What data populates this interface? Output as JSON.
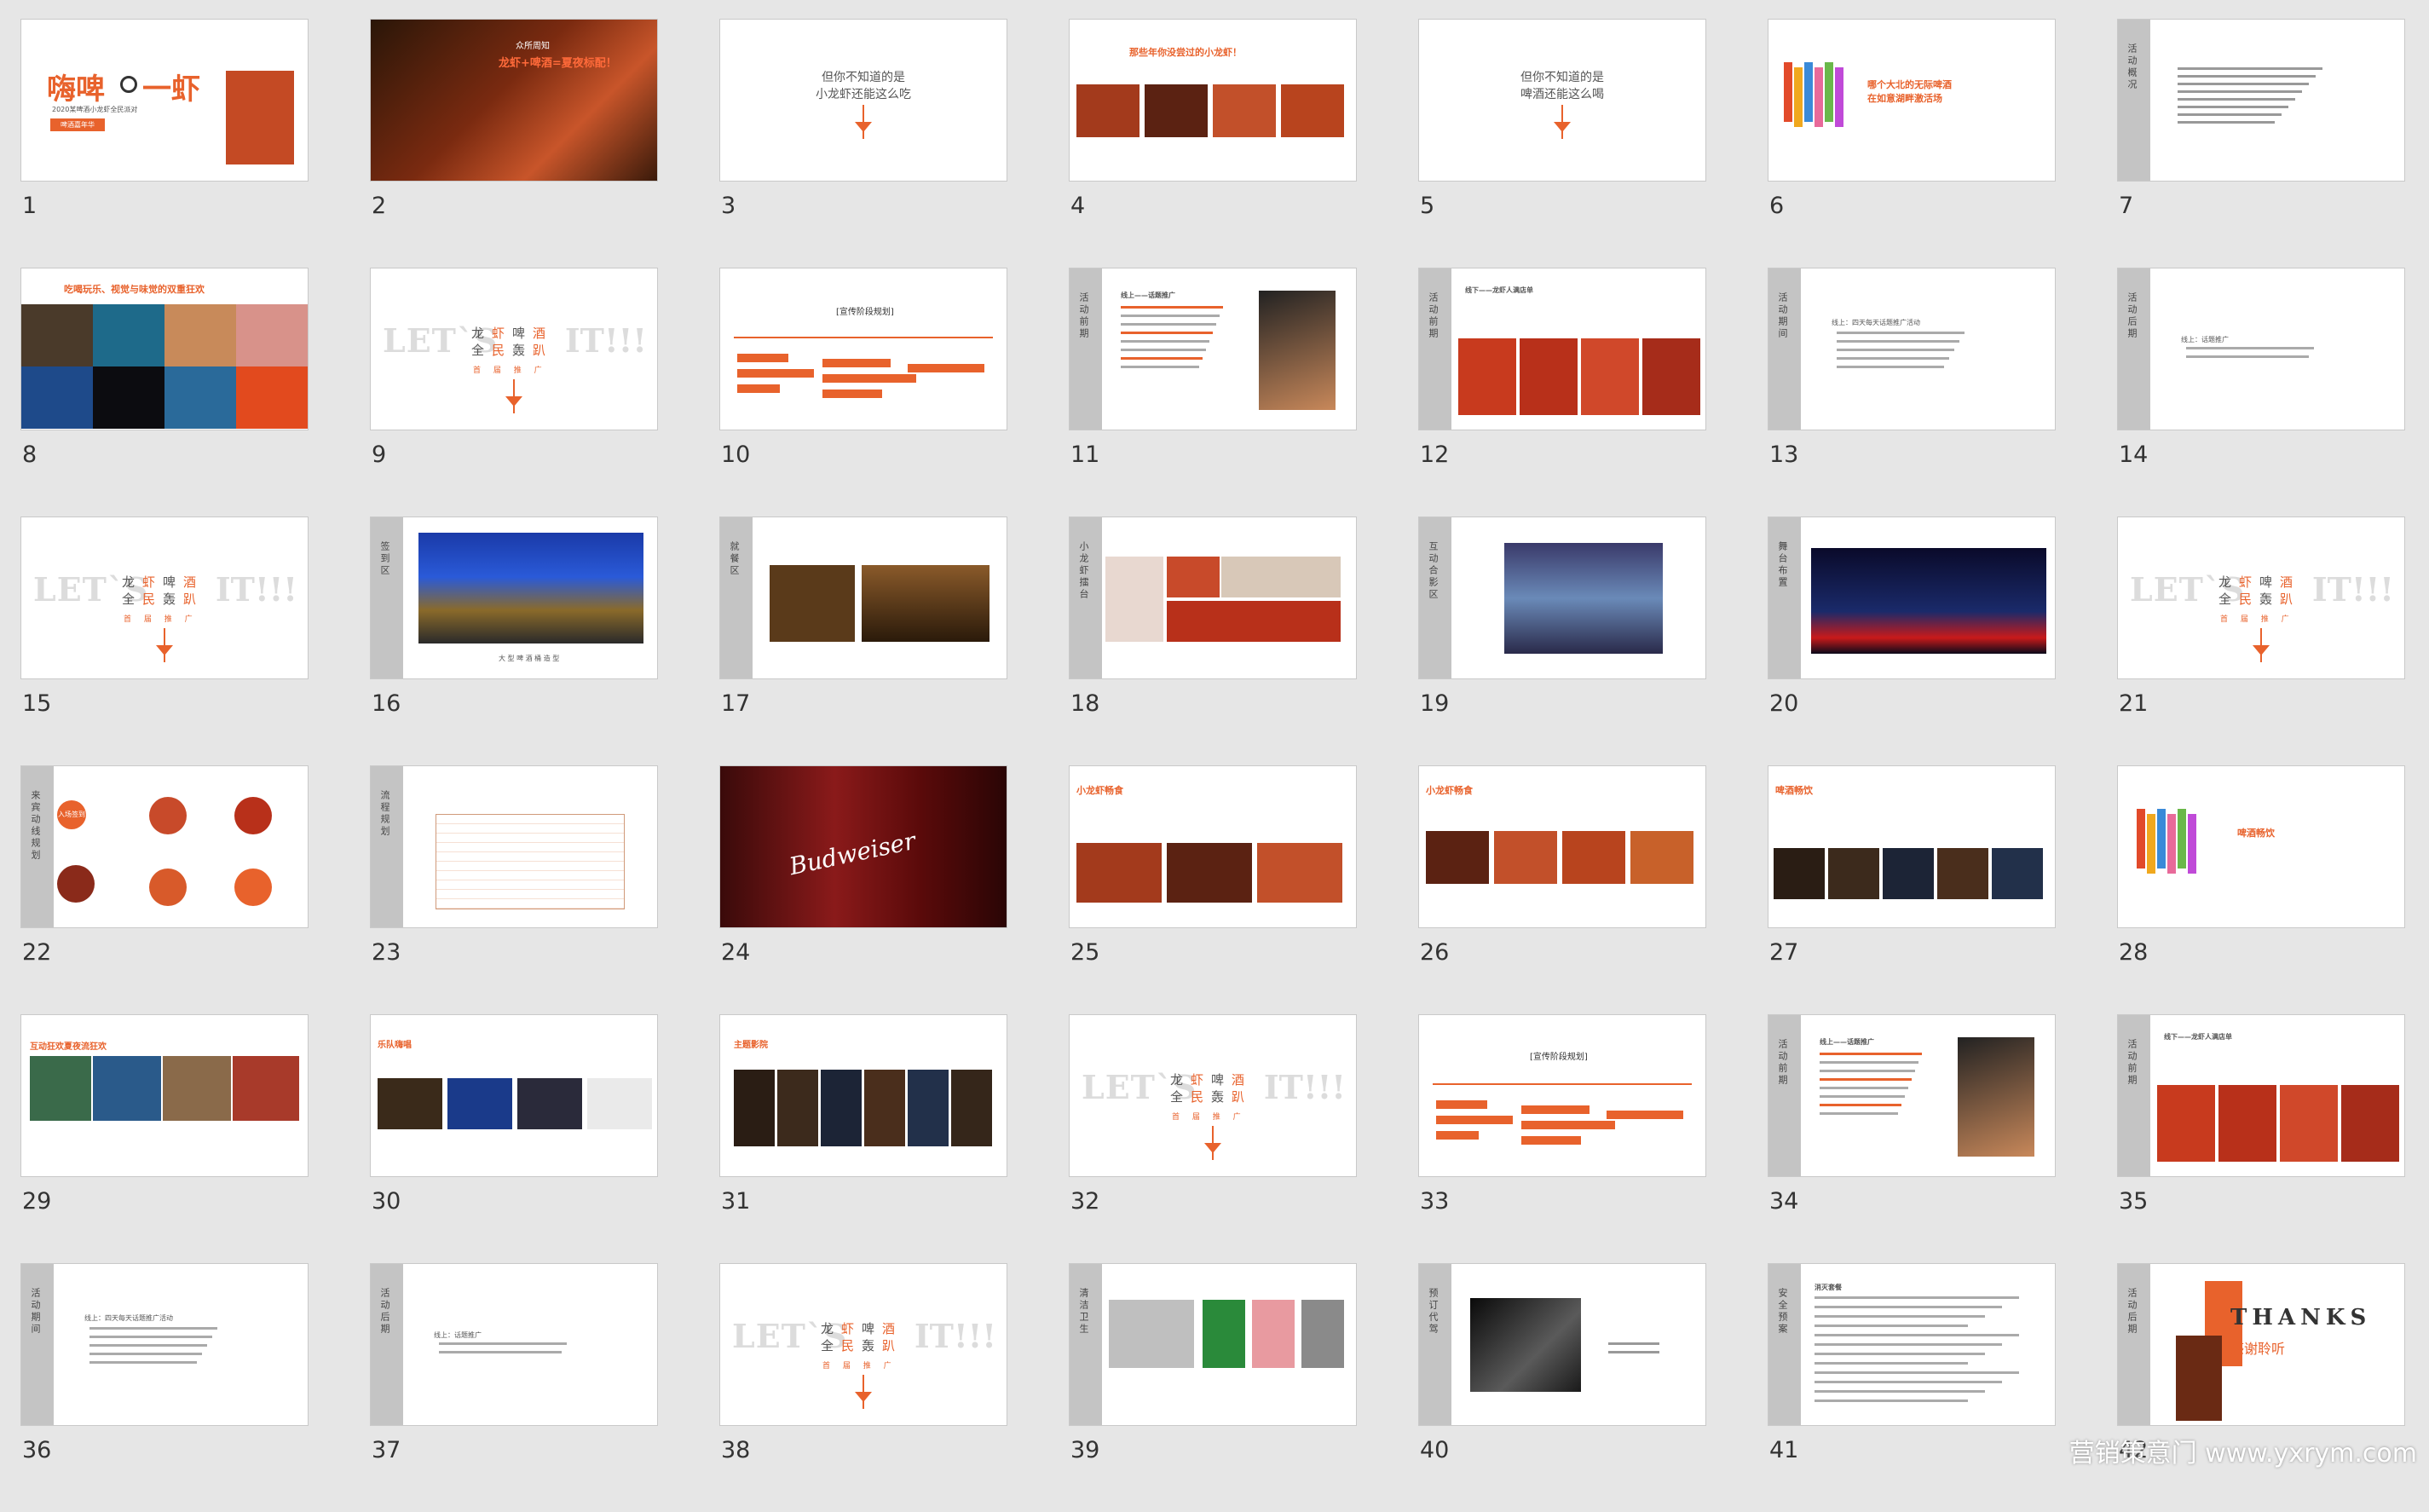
{
  "slides": [
    {
      "num": "1",
      "title": "嗨啤",
      "title2": "一虾",
      "subtitle": "2020某啤酒小龙虾全民派对",
      "tag": "啤酒嘉年华"
    },
    {
      "num": "2",
      "line1": "众所周知",
      "line2": "龙虾+啤酒=夏夜标配！"
    },
    {
      "num": "3",
      "line1": "但你不知道的是",
      "line2": "小龙虾还能这么吃"
    },
    {
      "num": "4",
      "title": "那些年你没尝过的小龙虾！"
    },
    {
      "num": "5",
      "line1": "但你不知道的是",
      "line2": "啤酒还能这么喝"
    },
    {
      "num": "6",
      "title": "哪个大北的无际啤酒",
      "title2": "在如意湖畔激活场"
    },
    {
      "num": "7",
      "side": "活动概况"
    },
    {
      "num": "8",
      "title": "吃喝玩乐、视觉与味觉的双重狂欢"
    },
    {
      "num": "9",
      "let": "LET`S",
      "it": "IT!!!"
    },
    {
      "num": "10",
      "title": "[宣传阶段规划]"
    },
    {
      "num": "11",
      "side": "活动前期",
      "title": "线上——话题推广"
    },
    {
      "num": "12",
      "side": "活动前期",
      "title": "线下——龙虾人满店单"
    },
    {
      "num": "13",
      "side": "活动期间",
      "title": "线上：四天每天话题推广活动"
    },
    {
      "num": "14",
      "side": "活动后期",
      "title": "线上：话题推广"
    },
    {
      "num": "15",
      "let": "LET`S",
      "it": "IT!!!"
    },
    {
      "num": "16",
      "side": "签到区",
      "caption": "大 型 啤 酒 桶 造 型"
    },
    {
      "num": "17",
      "side": "就餐区"
    },
    {
      "num": "18",
      "side": "小龙虾擂台"
    },
    {
      "num": "19",
      "side": "互动合影区"
    },
    {
      "num": "20",
      "side": "舞台布置"
    },
    {
      "num": "21",
      "let": "LET`S",
      "it": "IT!!!"
    },
    {
      "num": "22",
      "side": "来宾动线规划",
      "tag": "入场签到"
    },
    {
      "num": "23",
      "side": "流程规划"
    },
    {
      "num": "24",
      "brand": "Budweiser"
    },
    {
      "num": "25",
      "title": "小龙虾畅食"
    },
    {
      "num": "26",
      "title": "小龙虾畅食"
    },
    {
      "num": "27",
      "title": "啤酒畅饮"
    },
    {
      "num": "28",
      "title": "啤酒畅饮"
    },
    {
      "num": "29",
      "title": "互动狂欢夏夜流狂欢"
    },
    {
      "num": "30",
      "title": "乐队嗨唱"
    },
    {
      "num": "31",
      "title": "主题影院"
    },
    {
      "num": "32",
      "let": "LET`S",
      "it": "IT!!!"
    },
    {
      "num": "33",
      "title": "[宣传阶段规划]"
    },
    {
      "num": "34",
      "side": "活动前期",
      "title": "线上——话题推广"
    },
    {
      "num": "35",
      "side": "活动前期",
      "title": "线下——龙虾人满店单"
    },
    {
      "num": "36",
      "side": "活动期间",
      "title": "线上：四天每天话题推广活动"
    },
    {
      "num": "37",
      "side": "活动后期",
      "title": "线上：话题推广"
    },
    {
      "num": "38",
      "let": "LET`S",
      "it": "IT!!!"
    },
    {
      "num": "39",
      "side": "清洁卫生"
    },
    {
      "num": "40",
      "side": "预订代驾"
    },
    {
      "num": "41",
      "side": "安全预案",
      "title": "消灭套餐"
    },
    {
      "num": "42",
      "side": "活动后期",
      "thanks": "THANKS",
      "sub": "感谢聆听"
    }
  ],
  "cn_title": [
    "龙",
    "虾",
    "啤",
    "酒",
    "全",
    "民",
    "轰",
    "趴"
  ],
  "cn_sub": "首 届 推 广",
  "watermark": "营销策意门 www.yxrym.com",
  "colors": {
    "accent": "#e8622c",
    "sidebar": "#c4c4c4"
  }
}
